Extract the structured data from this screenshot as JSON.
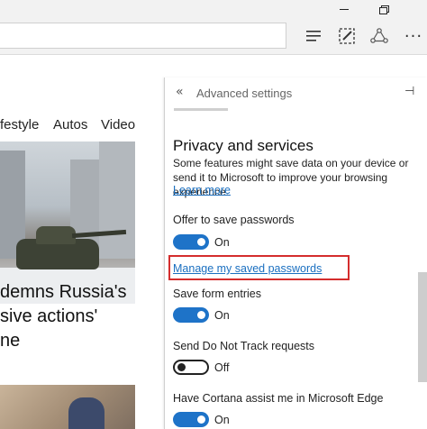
{
  "window": {
    "minimize_glyph": "",
    "restore_glyph": ""
  },
  "toolbar": {
    "more_glyph": "···"
  },
  "nav": {
    "items": [
      "festyle",
      "Autos",
      "Video"
    ]
  },
  "news": {
    "headline_lines": [
      "demns Russia's",
      "sive actions'",
      "ne"
    ]
  },
  "settings": {
    "header_title": "Advanced settings",
    "back_glyph": "«",
    "pin_glyph": "⊣",
    "section_title": "Privacy and services",
    "description": "Some features might save data on your device or send it to Microsoft to improve your browsing experience.",
    "learn_more": "Learn more",
    "offer_passwords": {
      "label": "Offer to save passwords",
      "state": "On"
    },
    "manage_passwords": "Manage my saved passwords",
    "save_form": {
      "label": "Save form entries",
      "state": "On"
    },
    "do_not_track": {
      "label": "Send Do Not Track requests",
      "state": "Off"
    },
    "cortana": {
      "label": "Have Cortana assist me in Microsoft Edge",
      "state": "On"
    }
  },
  "colors": {
    "accent": "#1e73c8",
    "link": "#1a6fc0",
    "highlight": "#d42d2d"
  }
}
